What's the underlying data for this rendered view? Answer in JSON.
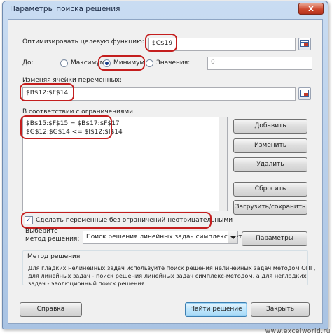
{
  "window": {
    "title": "Параметры поиска решения",
    "close_glyph": "x"
  },
  "objective": {
    "label": "Оптимизировать целевую функцию:",
    "value": "$C$19"
  },
  "goal": {
    "label": "До:",
    "options": [
      {
        "label": "Максимум",
        "selected": false
      },
      {
        "label": "Минимум",
        "selected": true
      },
      {
        "label": "Значения:",
        "selected": false
      }
    ],
    "value_field": "0"
  },
  "variables": {
    "label": "Изменяя ячейки переменных:",
    "value": "$B$12:$F$14"
  },
  "constraints": {
    "label": "В соответствии с ограничениями:",
    "items": [
      "$B$15:$F$15 = $B$17:$F$17",
      "$G$12:$G$14 <= $I$12:$I$14"
    ]
  },
  "constraint_buttons": {
    "add": "Добавить",
    "change": "Изменить",
    "delete": "Удалить",
    "reset": "Сбросить",
    "load_save": "Загрузить/сохранить"
  },
  "nonneg": {
    "label": "Сделать переменные без ограничений неотрицательными",
    "checked": true
  },
  "method": {
    "label_line1": "Выберите",
    "label_line2": "метод решения:",
    "selected": "Поиск решения линейных задач симплекс-методом",
    "params_button": "Параметры"
  },
  "method_group": {
    "title": "Метод решения",
    "description_line1": "Для гладких нелинейных задач используйте поиск решения нелинейных задач методом ОПГ,",
    "description_line2": "для линейных задач - поиск решения линейных задач симплекс-методом, а для негладких",
    "description_line3": "задач - эволюционный поиск решения."
  },
  "footer": {
    "help": "Справка",
    "solve": "Найти решение",
    "close": "Закрыть"
  },
  "watermark": "www.excelworld.ru",
  "colors": {
    "highlight": "#c41e1e",
    "title_bar": "#b9d1ee"
  }
}
